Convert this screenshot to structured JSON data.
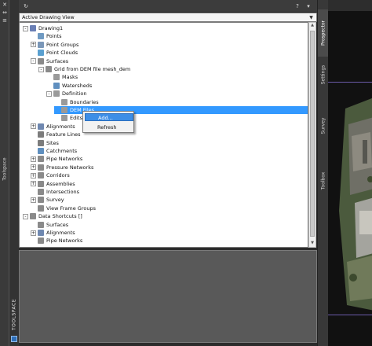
{
  "left_strip": {
    "close_icon": "✕",
    "pin_icon": "⇔",
    "props_icon": "≡",
    "label": "Toolspace"
  },
  "panel": {
    "title": "TOOLSPACE",
    "top_buttons": {
      "refresh": "↻",
      "help": "?",
      "dropdown": "▾",
      "close": "▫"
    }
  },
  "view_select": {
    "value": "Active Drawing View"
  },
  "tree": [
    {
      "label": "Drawing1",
      "level": 0,
      "exp": "-",
      "icon": "drawing",
      "color": "#6a7fb5"
    },
    {
      "label": "Points",
      "level": 1,
      "exp": "",
      "icon": "points",
      "color": "#6f9ac2"
    },
    {
      "label": "Point Groups",
      "level": 1,
      "exp": "+",
      "icon": "pointgroups",
      "color": "#7a97b8"
    },
    {
      "label": "Point Clouds",
      "level": 1,
      "exp": "",
      "icon": "pointclouds",
      "color": "#5aa0d0"
    },
    {
      "label": "Surfaces",
      "level": 1,
      "exp": "-",
      "icon": "surfaces",
      "color": "#8a8a8a"
    },
    {
      "label": "Grid from DEM file mesh_dem",
      "level": 2,
      "exp": "-",
      "icon": "surface",
      "color": "#8a8a8a"
    },
    {
      "label": "Masks",
      "level": 3,
      "exp": "",
      "icon": "masks",
      "color": "#9a9a9a"
    },
    {
      "label": "Watersheds",
      "level": 3,
      "exp": "",
      "icon": "watersheds",
      "color": "#5f8fbf"
    },
    {
      "label": "Definition",
      "level": 3,
      "exp": "-",
      "icon": "definition",
      "color": "#9a9a9a"
    },
    {
      "label": "Boundaries",
      "level": 4,
      "exp": "",
      "icon": "boundaries",
      "color": "#9a9a9a"
    },
    {
      "label": "DEM Files",
      "level": 4,
      "exp": "",
      "icon": "demfiles",
      "color": "#9a9a9a",
      "selected": true
    },
    {
      "label": "Edits",
      "level": 4,
      "exp": "",
      "icon": "edits",
      "color": "#9a9a9a"
    },
    {
      "label": "Alignments",
      "level": 1,
      "exp": "+",
      "icon": "alignments",
      "color": "#6f88b0"
    },
    {
      "label": "Feature Lines",
      "level": 1,
      "exp": "",
      "icon": "featurelines",
      "color": "#7c7c7c"
    },
    {
      "label": "Sites",
      "level": 1,
      "exp": "",
      "icon": "sites",
      "color": "#7c7c7c"
    },
    {
      "label": "Catchments",
      "level": 1,
      "exp": "",
      "icon": "catchments",
      "color": "#5f8fbf"
    },
    {
      "label": "Pipe Networks",
      "level": 1,
      "exp": "+",
      "icon": "pipenetworks",
      "color": "#8a8a8a"
    },
    {
      "label": "Pressure Networks",
      "level": 1,
      "exp": "+",
      "icon": "pressurenetworks",
      "color": "#8a8a8a"
    },
    {
      "label": "Corridors",
      "level": 1,
      "exp": "+",
      "icon": "corridors",
      "color": "#8a8a8a"
    },
    {
      "label": "Assemblies",
      "level": 1,
      "exp": "+",
      "icon": "assemblies",
      "color": "#8a8a8a"
    },
    {
      "label": "Intersections",
      "level": 1,
      "exp": "",
      "icon": "intersections",
      "color": "#8a8a8a"
    },
    {
      "label": "Survey",
      "level": 1,
      "exp": "+",
      "icon": "survey",
      "color": "#8a8a8a"
    },
    {
      "label": "View Frame Groups",
      "level": 1,
      "exp": "",
      "icon": "viewframegroups",
      "color": "#8a8a8a"
    },
    {
      "label": "Data Shortcuts []",
      "level": 0,
      "exp": "-",
      "icon": "datashortcuts",
      "color": "#8a8a8a"
    },
    {
      "label": "Surfaces",
      "level": 1,
      "exp": "",
      "icon": "surfaces",
      "color": "#8a8a8a"
    },
    {
      "label": "Alignments",
      "level": 1,
      "exp": "+",
      "icon": "alignments",
      "color": "#6f88b0"
    },
    {
      "label": "Pipe Networks",
      "level": 1,
      "exp": "",
      "icon": "pipenetworks",
      "color": "#8a8a8a"
    }
  ],
  "context_menu": {
    "items": [
      {
        "label": "Add...",
        "highlighted": true
      },
      {
        "label": "Refresh",
        "highlighted": false
      }
    ]
  },
  "right_tabs": [
    {
      "label": "Prospector",
      "active": true
    },
    {
      "label": "Settings",
      "active": false
    },
    {
      "label": "Survey",
      "active": false
    },
    {
      "label": "Toolbox",
      "active": false
    }
  ],
  "colors": {
    "selection": "#3399ff",
    "menu_highlight": "#3d8ee6",
    "panel_bg": "#2b2b2b"
  }
}
